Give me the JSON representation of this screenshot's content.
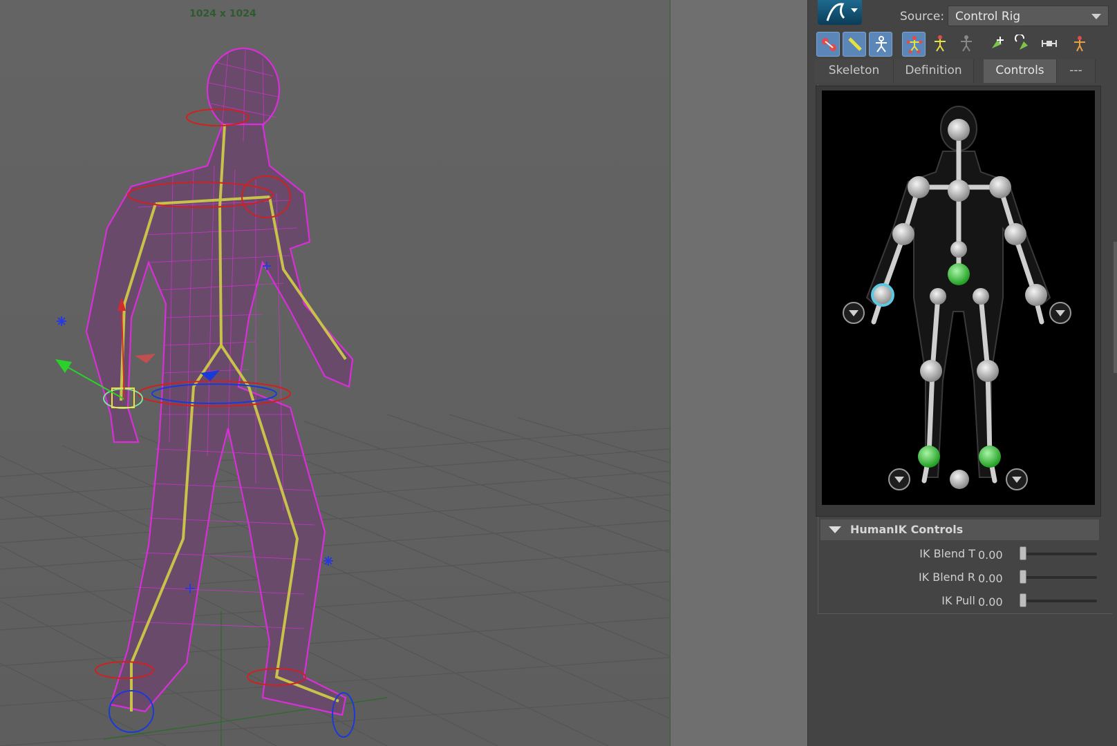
{
  "viewport": {
    "resolution_label": "1024 x 1024"
  },
  "panel": {
    "source_label": "Source:",
    "source_value": "Control Rig",
    "toolbar": [
      {
        "icon": "show-skeleton-icon",
        "active": true
      },
      {
        "icon": "bone-ruler-icon",
        "active": true
      },
      {
        "icon": "stick-figure-icon",
        "active": true
      },
      {
        "icon": "full-body-ik-icon",
        "active": true
      },
      {
        "icon": "body-part-icon",
        "active": false
      },
      {
        "icon": "selection-figure-icon",
        "active": false
      },
      {
        "icon": "pin-translate-icon",
        "active": false
      },
      {
        "icon": "pin-rotate-icon",
        "active": false
      },
      {
        "icon": "release-pin-icon",
        "active": false
      },
      {
        "icon": "stance-figure-icon",
        "active": false
      }
    ],
    "tabs": [
      {
        "label": "Skeleton",
        "active": false
      },
      {
        "label": "Definition",
        "active": false
      },
      {
        "label": "Controls",
        "active": true
      },
      {
        "label": "---",
        "active": false
      }
    ],
    "section": {
      "title": "HumanIK Controls",
      "sliders": [
        {
          "label": "IK Blend T",
          "value": "0.00",
          "fraction": 0
        },
        {
          "label": "IK Blend R",
          "value": "0.00",
          "fraction": 0
        },
        {
          "label": "IK Pull",
          "value": "0.00",
          "fraction": 0
        }
      ]
    }
  },
  "colors": {
    "selected_joint": "#4ed04e",
    "highlight_ring": "#5ec8e0",
    "toolbar_active": "#5a86b8",
    "wireframe": "#d92fd9",
    "skeleton": "#c9c24a"
  }
}
